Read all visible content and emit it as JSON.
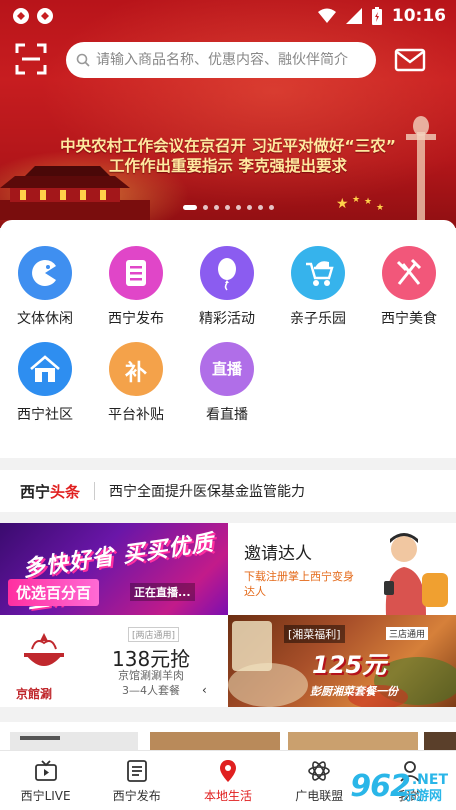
{
  "status_bar": {
    "time": "10:16"
  },
  "header": {
    "search_placeholder": "请输入商品名称、优惠内容、融伙伴简介"
  },
  "banner": {
    "headline_line1": "中央农村工作会议在京召开  习近平对做好“三农”",
    "headline_line2": "工作作出重要指示  李克强提出要求",
    "slide_count": 8,
    "active_slide": 1
  },
  "categories": [
    {
      "label": "文体休闲",
      "icon": "game-icon",
      "color": "#3f8ff0"
    },
    {
      "label": "西宁发布",
      "icon": "document-icon",
      "color": "#e046c8"
    },
    {
      "label": "精彩活动",
      "icon": "balloon-icon",
      "color": "#8b5cf0"
    },
    {
      "label": "亲子乐园",
      "icon": "stroller-icon",
      "color": "#36b3ec"
    },
    {
      "label": "西宁美食",
      "icon": "cutlery-icon",
      "color": "#f2577a"
    },
    {
      "label": "西宁社区",
      "icon": "home-icon",
      "color": "#2e8ef0"
    },
    {
      "label": "平台补贴",
      "icon": "subsidy-icon",
      "icon_text": "补",
      "color": "#f4a24a"
    },
    {
      "label": "看直播",
      "icon": "live-icon",
      "icon_text": "直播",
      "color": "#b06ee8"
    }
  ],
  "ticker": {
    "brand_part1": "西宁",
    "brand_part2": "头条",
    "text": "西宁全面提升医保基金监管能力"
  },
  "promos": {
    "p1": {
      "title": "多快好省 买买优质生活",
      "tag": "优选百分百",
      "live": "正在直播..."
    },
    "p2": {
      "title": "邀请达人",
      "subtitle": "下载注册掌上西宁变身达人"
    },
    "p3": {
      "brand": "京館涮",
      "tag": "[两店通用]",
      "price": "138元抢",
      "desc1": "京馆涮涮羊肉",
      "desc2": "3—4人套餐",
      "arrow": "‹"
    },
    "p4": {
      "tag": "[湘菜福利]",
      "tag2": "三店通用",
      "price": "125元",
      "subtitle": "彭厨湘菜套餐一份"
    }
  },
  "bottom_nav": [
    {
      "label": "西宁LIVE",
      "icon": "tv-icon",
      "active": false
    },
    {
      "label": "西宁发布",
      "icon": "news-icon",
      "active": false
    },
    {
      "label": "本地生活",
      "icon": "location-icon",
      "active": true
    },
    {
      "label": "广电联盟",
      "icon": "atom-icon",
      "active": false
    },
    {
      "label": "我的",
      "icon": "user-icon",
      "active": false
    }
  ],
  "watermark": {
    "num": "962",
    "net": ".NET",
    "cn": "乐游网"
  },
  "colors": {
    "brand_red": "#e02020",
    "hero_red": "#c71d20"
  }
}
